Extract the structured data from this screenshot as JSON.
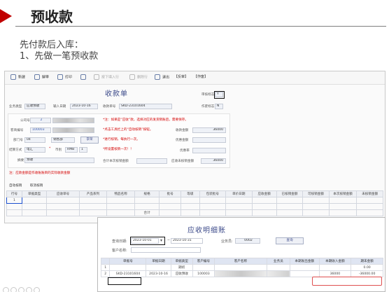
{
  "slide": {
    "title": "预收款",
    "line1": "先付款后入库：",
    "line2": "1、先做一笔预收款"
  },
  "toolbar": {
    "new": "新建",
    "unaudit": "解审",
    "print": "打印",
    "pagedown": "按下填入行",
    "delete_row": "删除行",
    "exit": "退出",
    "audit": "【反审】",
    "void": "【作废】"
  },
  "form": {
    "title": "收款单",
    "audit_flag_label": "审核标志",
    "audit_flag_value": "Y",
    "bill_type_label": "业务类型",
    "bill_type_value": "应收预收",
    "entry_date_label": "输入日期",
    "entry_date_value": "2023-10-16",
    "receipt_no_label": "收款单号",
    "receipt_no_value": "SKD-23101604",
    "void_flag_label": "作废标志",
    "void_flag_value": "N",
    "company_label": "公司号",
    "company_value": "2",
    "customer_label": "客商编号",
    "customer_value": "100003",
    "dept_label": "部门号",
    "dept_value": "04",
    "dept_name": "销售部",
    "staff_btn": "李荣",
    "settle_label": "结算方式",
    "settle_value": "电汇",
    "currency_label": "币别",
    "currency_value": "RMB",
    "currency_rate": "1",
    "summary_label": "摘要",
    "summary_value": "预收",
    "note1": "*注：如果是“应收”款，选择对应的发货销账后，需要保存。",
    "note2": "*点击工具栏上的“自动核销”按钮。",
    "note3": "*进行核销，每执行一次。",
    "note4": "*所设置核销一次！！",
    "remark": "注：应款金额是作收账账目的实际收款金额",
    "amount_label": "收款金额",
    "amount_value": "36000",
    "discount_label": "优惠金额",
    "prepay_label": "优惠率",
    "this_write_label": "合计本次核销金额",
    "receivable_label": "应收未核销金额",
    "receivable_value": "36000"
  },
  "grid1": {
    "tabs": [
      "自动核销",
      "取消核销"
    ],
    "headers": [
      "行号",
      "单据类型",
      "应收单号",
      "产品系列",
      "物品名称",
      "规格",
      "批号",
      "等级",
      "包装批号",
      "单价日期",
      "应收金额",
      "已核销金额",
      "可核销金额",
      "本次核销金额",
      "未核销金额"
    ],
    "first_row_no": "1",
    "total_label": "合计"
  },
  "window2": {
    "title": "应收明细账",
    "query_date_label": "查询日期:",
    "date_from": "2023-10-01",
    "tilde": "~",
    "date_to": "2023-10-31",
    "salesman_label": "业务员:",
    "salesman_value": "0002",
    "customer_label": "客户名称:",
    "query_btn": "查询",
    "headers": [
      "",
      "单据号",
      "单据日期",
      "单据类型",
      "客户编号",
      "客户名称",
      "业务员",
      "本期发出金额",
      "本期收入金额",
      "期末金额"
    ],
    "rows": [
      {
        "no": "1",
        "doc": "",
        "date": "",
        "type": "期初",
        "cust": "",
        "name": "",
        "sales": "",
        "out": "",
        "in": "",
        "end": "0.00"
      },
      {
        "no": "2",
        "doc": "SKD-23101604",
        "date": "2023-10-16",
        "type": "应收预收",
        "cust": "100003",
        "name": "",
        "sales": "",
        "out": "",
        "in": "36000",
        "end": "-36000.00"
      }
    ]
  },
  "colors": {
    "accent_red": "#c00000",
    "title_blue": "#3c4a8a",
    "note_red": "#d40000"
  }
}
